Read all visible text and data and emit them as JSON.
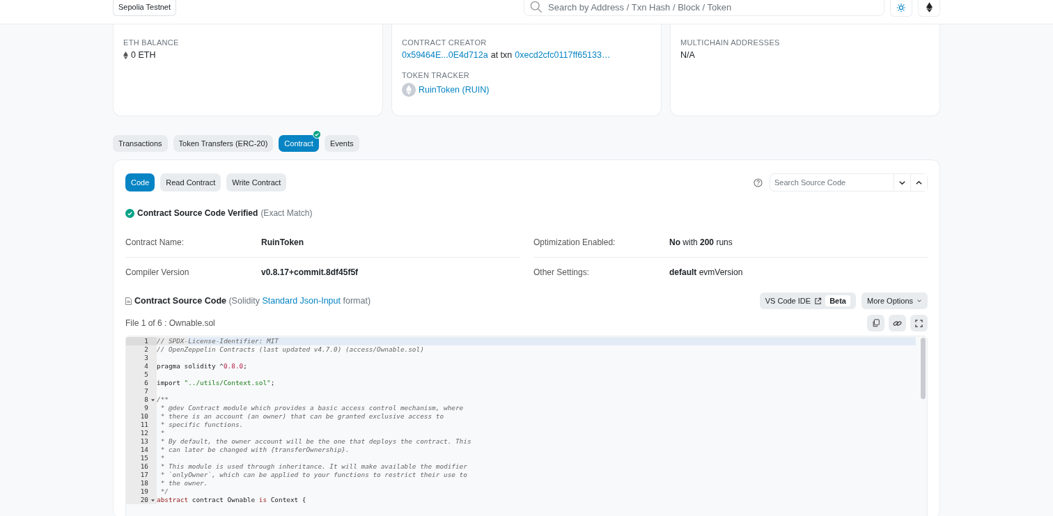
{
  "header": {
    "network_badge": "Sepolia Testnet",
    "search": {
      "placeholder": "Search by Address / Txn Hash / Block / Token"
    }
  },
  "cards": [
    {
      "sections": [
        {
          "label": "ETH BALANCE",
          "kind": "balance",
          "value": "0 ETH"
        }
      ]
    },
    {
      "sections": [
        {
          "label": "CONTRACT CREATOR",
          "kind": "creator",
          "creator": "0x59464E...0E4d712a",
          "joiner": "at txn",
          "txn": "0xecd2cfc0117ff65133…"
        },
        {
          "label": "TOKEN TRACKER",
          "kind": "token",
          "value": "RuinToken (RUIN)"
        }
      ]
    },
    {
      "sections": [
        {
          "label": "MULTICHAIN ADDRESSES",
          "kind": "plain",
          "value": "N/A"
        }
      ]
    }
  ],
  "tabs": [
    {
      "label": "Transactions",
      "selected": false,
      "verified": false
    },
    {
      "label": "Token Transfers (ERC-20)",
      "selected": false,
      "verified": false
    },
    {
      "label": "Contract",
      "selected": true,
      "verified": true
    },
    {
      "label": "Events",
      "selected": false,
      "verified": false
    }
  ],
  "subtabs": [
    {
      "label": "Code",
      "selected": true
    },
    {
      "label": "Read Contract",
      "selected": false
    },
    {
      "label": "Write Contract",
      "selected": false
    }
  ],
  "source_search": {
    "placeholder": "Search Source Code"
  },
  "verified": {
    "title": "Contract Source Code Verified",
    "note": "(Exact Match)"
  },
  "info": [
    {
      "label": "Contract Name:",
      "value": "RuinToken",
      "emphasis": true
    },
    {
      "label": "Optimization Enabled:",
      "value": "**No** with **200** runs",
      "emphasis": false
    },
    {
      "label": "Compiler Version",
      "value": "v0.8.17+commit.8df45f5f",
      "emphasis": true
    },
    {
      "label": "Other Settings:",
      "value": "**default** evmVersion",
      "emphasis": false
    }
  ],
  "source": {
    "title": "Contract Source Code",
    "note_before": "(Solidity",
    "link": "Standard Json-Input",
    "note_after": "format)",
    "ide_button": "VS Code IDE",
    "ide_badge": "Beta",
    "more_button": "More Options",
    "file_label": "File 1 of 6 : Ownable.sol"
  },
  "code": [
    {
      "number": "1",
      "active": true,
      "foldable": false,
      "segments": [
        {
          "kind": "comment",
          "text": "// SPDX-License-Identifier: MIT"
        }
      ]
    },
    {
      "number": "2",
      "active": false,
      "foldable": false,
      "segments": [
        {
          "kind": "comment",
          "text": "// OpenZeppelin Contracts (last updated v4.7.0) (access/Ownable.sol)"
        }
      ]
    },
    {
      "number": "3",
      "active": false,
      "foldable": false
    },
    {
      "number": "4",
      "active": false,
      "foldable": false,
      "segments": [
        {
          "kind": "plain",
          "text": "pragma solidity ^"
        },
        {
          "kind": "number",
          "text": "0.8.0"
        },
        {
          "kind": "plain",
          "text": ";"
        }
      ]
    },
    {
      "number": "5",
      "active": false,
      "foldable": false
    },
    {
      "number": "6",
      "active": false,
      "foldable": false,
      "segments": [
        {
          "kind": "plain",
          "text": "import "
        },
        {
          "kind": "string",
          "text": "\"../utils/Context.sol\""
        },
        {
          "kind": "plain",
          "text": ";"
        }
      ]
    },
    {
      "number": "7",
      "active": false,
      "foldable": false
    },
    {
      "number": "8",
      "active": false,
      "foldable": true,
      "segments": [
        {
          "kind": "comment",
          "text": "/**"
        }
      ]
    },
    {
      "number": "9",
      "active": false,
      "foldable": false,
      "segments": [
        {
          "kind": "comment",
          "text": " * @dev Contract module which provides a basic access control mechanism, where"
        }
      ]
    },
    {
      "number": "10",
      "active": false,
      "foldable": false,
      "segments": [
        {
          "kind": "comment",
          "text": " * there is an account (an owner) that can be granted exclusive access to"
        }
      ]
    },
    {
      "number": "11",
      "active": false,
      "foldable": false,
      "segments": [
        {
          "kind": "comment",
          "text": " * specific functions."
        }
      ]
    },
    {
      "number": "12",
      "active": false,
      "foldable": false,
      "segments": [
        {
          "kind": "comment",
          "text": " *"
        }
      ]
    },
    {
      "number": "13",
      "active": false,
      "foldable": false,
      "segments": [
        {
          "kind": "comment",
          "text": " * By default, the owner account will be the one that deploys the contract. This"
        }
      ]
    },
    {
      "number": "14",
      "active": false,
      "foldable": false,
      "segments": [
        {
          "kind": "comment",
          "text": " * can later be changed with {transferOwnership}."
        }
      ]
    },
    {
      "number": "15",
      "active": false,
      "foldable": false,
      "segments": [
        {
          "kind": "comment",
          "text": " *"
        }
      ]
    },
    {
      "number": "16",
      "active": false,
      "foldable": false,
      "segments": [
        {
          "kind": "comment",
          "text": " * This module is used through inheritance. It will make available the modifier"
        }
      ]
    },
    {
      "number": "17",
      "active": false,
      "foldable": false,
      "segments": [
        {
          "kind": "comment",
          "text": " * `onlyOwner`, which can be applied to your functions to restrict their use to"
        }
      ]
    },
    {
      "number": "18",
      "active": false,
      "foldable": false,
      "segments": [
        {
          "kind": "comment",
          "text": " * the owner."
        }
      ]
    },
    {
      "number": "19",
      "active": false,
      "foldable": false,
      "segments": [
        {
          "kind": "comment",
          "text": " */"
        }
      ]
    },
    {
      "number": "20",
      "active": false,
      "foldable": true,
      "segments": [
        {
          "kind": "keyword",
          "text": "abstract"
        },
        {
          "kind": "plain",
          "text": " contract Ownable "
        },
        {
          "kind": "keyword",
          "text": "is"
        },
        {
          "kind": "plain",
          "text": " Context {"
        }
      ]
    }
  ]
}
